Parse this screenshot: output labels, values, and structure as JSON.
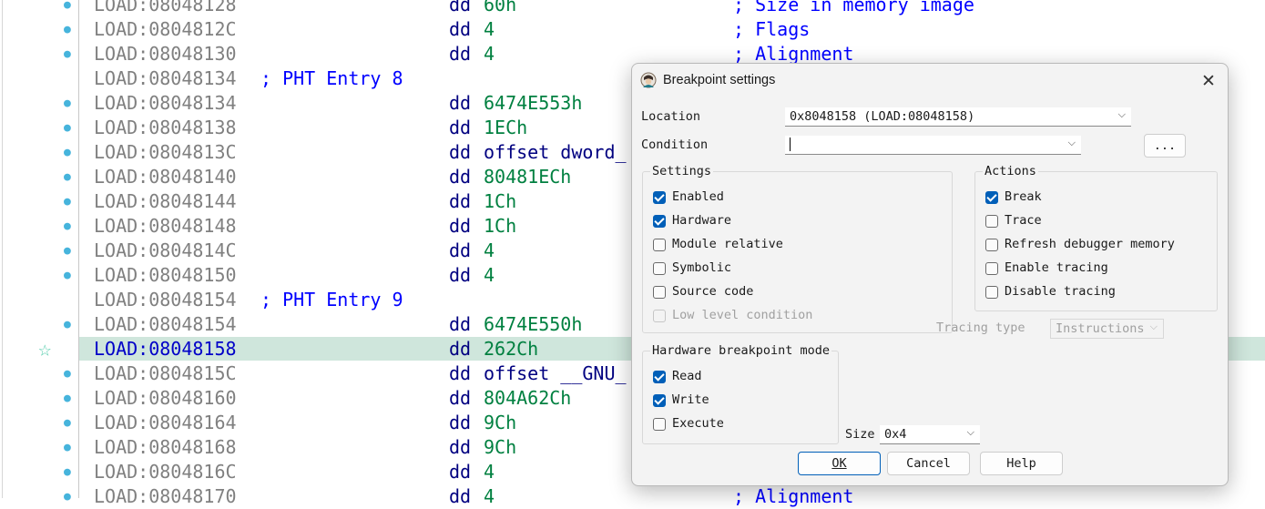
{
  "listing": {
    "rows": [
      {
        "address": "LOAD:08048128",
        "comment": "",
        "mnemonic": "dd",
        "operand": "60h",
        "operand_kind": "num",
        "remark": "; Size in memory image",
        "marker": "dot",
        "highlight": false
      },
      {
        "address": "LOAD:0804812C",
        "comment": "",
        "mnemonic": "dd",
        "operand": "4",
        "operand_kind": "num",
        "remark": "; Flags",
        "marker": "dot",
        "highlight": false
      },
      {
        "address": "LOAD:08048130",
        "comment": "",
        "mnemonic": "dd",
        "operand": "4",
        "operand_kind": "num",
        "remark": "; Alignment",
        "marker": "dot",
        "highlight": false
      },
      {
        "address": "LOAD:08048134",
        "comment": "; PHT Entry 8",
        "mnemonic": "",
        "operand": "",
        "operand_kind": "num",
        "remark": "",
        "marker": "",
        "highlight": false
      },
      {
        "address": "LOAD:08048134",
        "comment": "",
        "mnemonic": "dd",
        "operand": "6474E553h",
        "operand_kind": "num",
        "remark": "",
        "marker": "dot",
        "highlight": false
      },
      {
        "address": "LOAD:08048138",
        "comment": "",
        "mnemonic": "dd",
        "operand": "1ECh",
        "operand_kind": "num",
        "remark": "",
        "marker": "dot",
        "highlight": false
      },
      {
        "address": "LOAD:0804813C",
        "comment": "",
        "mnemonic": "dd",
        "operand": "offset dword_",
        "operand_kind": "name",
        "remark": "",
        "marker": "dot",
        "highlight": false
      },
      {
        "address": "LOAD:08048140",
        "comment": "",
        "mnemonic": "dd",
        "operand": "80481ECh",
        "operand_kind": "num",
        "remark": "",
        "marker": "dot",
        "highlight": false
      },
      {
        "address": "LOAD:08048144",
        "comment": "",
        "mnemonic": "dd",
        "operand": "1Ch",
        "operand_kind": "num",
        "remark": "",
        "marker": "dot",
        "highlight": false
      },
      {
        "address": "LOAD:08048148",
        "comment": "",
        "mnemonic": "dd",
        "operand": "1Ch",
        "operand_kind": "num",
        "remark": "",
        "marker": "dot",
        "highlight": false
      },
      {
        "address": "LOAD:0804814C",
        "comment": "",
        "mnemonic": "dd",
        "operand": "4",
        "operand_kind": "num",
        "remark": "",
        "marker": "dot",
        "highlight": false
      },
      {
        "address": "LOAD:08048150",
        "comment": "",
        "mnemonic": "dd",
        "operand": "4",
        "operand_kind": "num",
        "remark": "",
        "marker": "dot",
        "highlight": false
      },
      {
        "address": "LOAD:08048154",
        "comment": "; PHT Entry 9",
        "mnemonic": "",
        "operand": "",
        "operand_kind": "num",
        "remark": "",
        "marker": "",
        "highlight": false
      },
      {
        "address": "LOAD:08048154",
        "comment": "",
        "mnemonic": "dd",
        "operand": "6474E550h",
        "operand_kind": "num",
        "remark": "",
        "marker": "dot",
        "highlight": false
      },
      {
        "address": "LOAD:08048158",
        "comment": "",
        "mnemonic": "dd",
        "operand": "262Ch",
        "operand_kind": "num",
        "remark": "",
        "marker": "star",
        "highlight": true
      },
      {
        "address": "LOAD:0804815C",
        "comment": "",
        "mnemonic": "dd",
        "operand": "offset __GNU_",
        "operand_kind": "name",
        "remark": "",
        "marker": "dot",
        "highlight": false
      },
      {
        "address": "LOAD:08048160",
        "comment": "",
        "mnemonic": "dd",
        "operand": "804A62Ch",
        "operand_kind": "num",
        "remark": "",
        "marker": "dot",
        "highlight": false
      },
      {
        "address": "LOAD:08048164",
        "comment": "",
        "mnemonic": "dd",
        "operand": "9Ch",
        "operand_kind": "num",
        "remark": "",
        "marker": "dot",
        "highlight": false
      },
      {
        "address": "LOAD:08048168",
        "comment": "",
        "mnemonic": "dd",
        "operand": "9Ch",
        "operand_kind": "num",
        "remark": "",
        "marker": "dot",
        "highlight": false
      },
      {
        "address": "LOAD:0804816C",
        "comment": "",
        "mnemonic": "dd",
        "operand": "4",
        "operand_kind": "num",
        "remark": "",
        "marker": "dot",
        "highlight": false
      },
      {
        "address": "LOAD:08048170",
        "comment": "",
        "mnemonic": "dd",
        "operand": "4",
        "operand_kind": "num",
        "remark": "; Alignment",
        "marker": "dot",
        "highlight": false
      }
    ]
  },
  "dialog": {
    "title": "Breakpoint settings",
    "location_label": "Location",
    "location_value": "0x8048158 (LOAD:08048158)",
    "condition_label": "Condition",
    "condition_value": "",
    "ellipsis_button": "...",
    "settings": {
      "label": "Settings",
      "items": [
        {
          "label": "Enabled",
          "checked": true,
          "disabled": false
        },
        {
          "label": "Hardware",
          "checked": true,
          "disabled": false
        },
        {
          "label": "Module relative",
          "checked": false,
          "disabled": false
        },
        {
          "label": "Symbolic",
          "checked": false,
          "disabled": false
        },
        {
          "label": "Source code",
          "checked": false,
          "disabled": false
        },
        {
          "label": "Low level condition",
          "checked": false,
          "disabled": true
        }
      ]
    },
    "actions": {
      "label": "Actions",
      "items": [
        {
          "label": "Break",
          "checked": true
        },
        {
          "label": "Trace",
          "checked": false
        },
        {
          "label": "Refresh debugger memory",
          "checked": false
        },
        {
          "label": "Enable tracing",
          "checked": false
        },
        {
          "label": "Disable tracing",
          "checked": false
        }
      ]
    },
    "tracing_type_label": "Tracing type",
    "tracing_type_value": "Instructions",
    "hw_mode": {
      "label": "Hardware breakpoint mode",
      "items": [
        {
          "label": "Read",
          "checked": true
        },
        {
          "label": "Write",
          "checked": true
        },
        {
          "label": "Execute",
          "checked": false
        }
      ]
    },
    "size_label": "Size",
    "size_value": "0x4",
    "buttons": {
      "ok": "OK",
      "cancel": "Cancel",
      "help": "Help"
    }
  }
}
